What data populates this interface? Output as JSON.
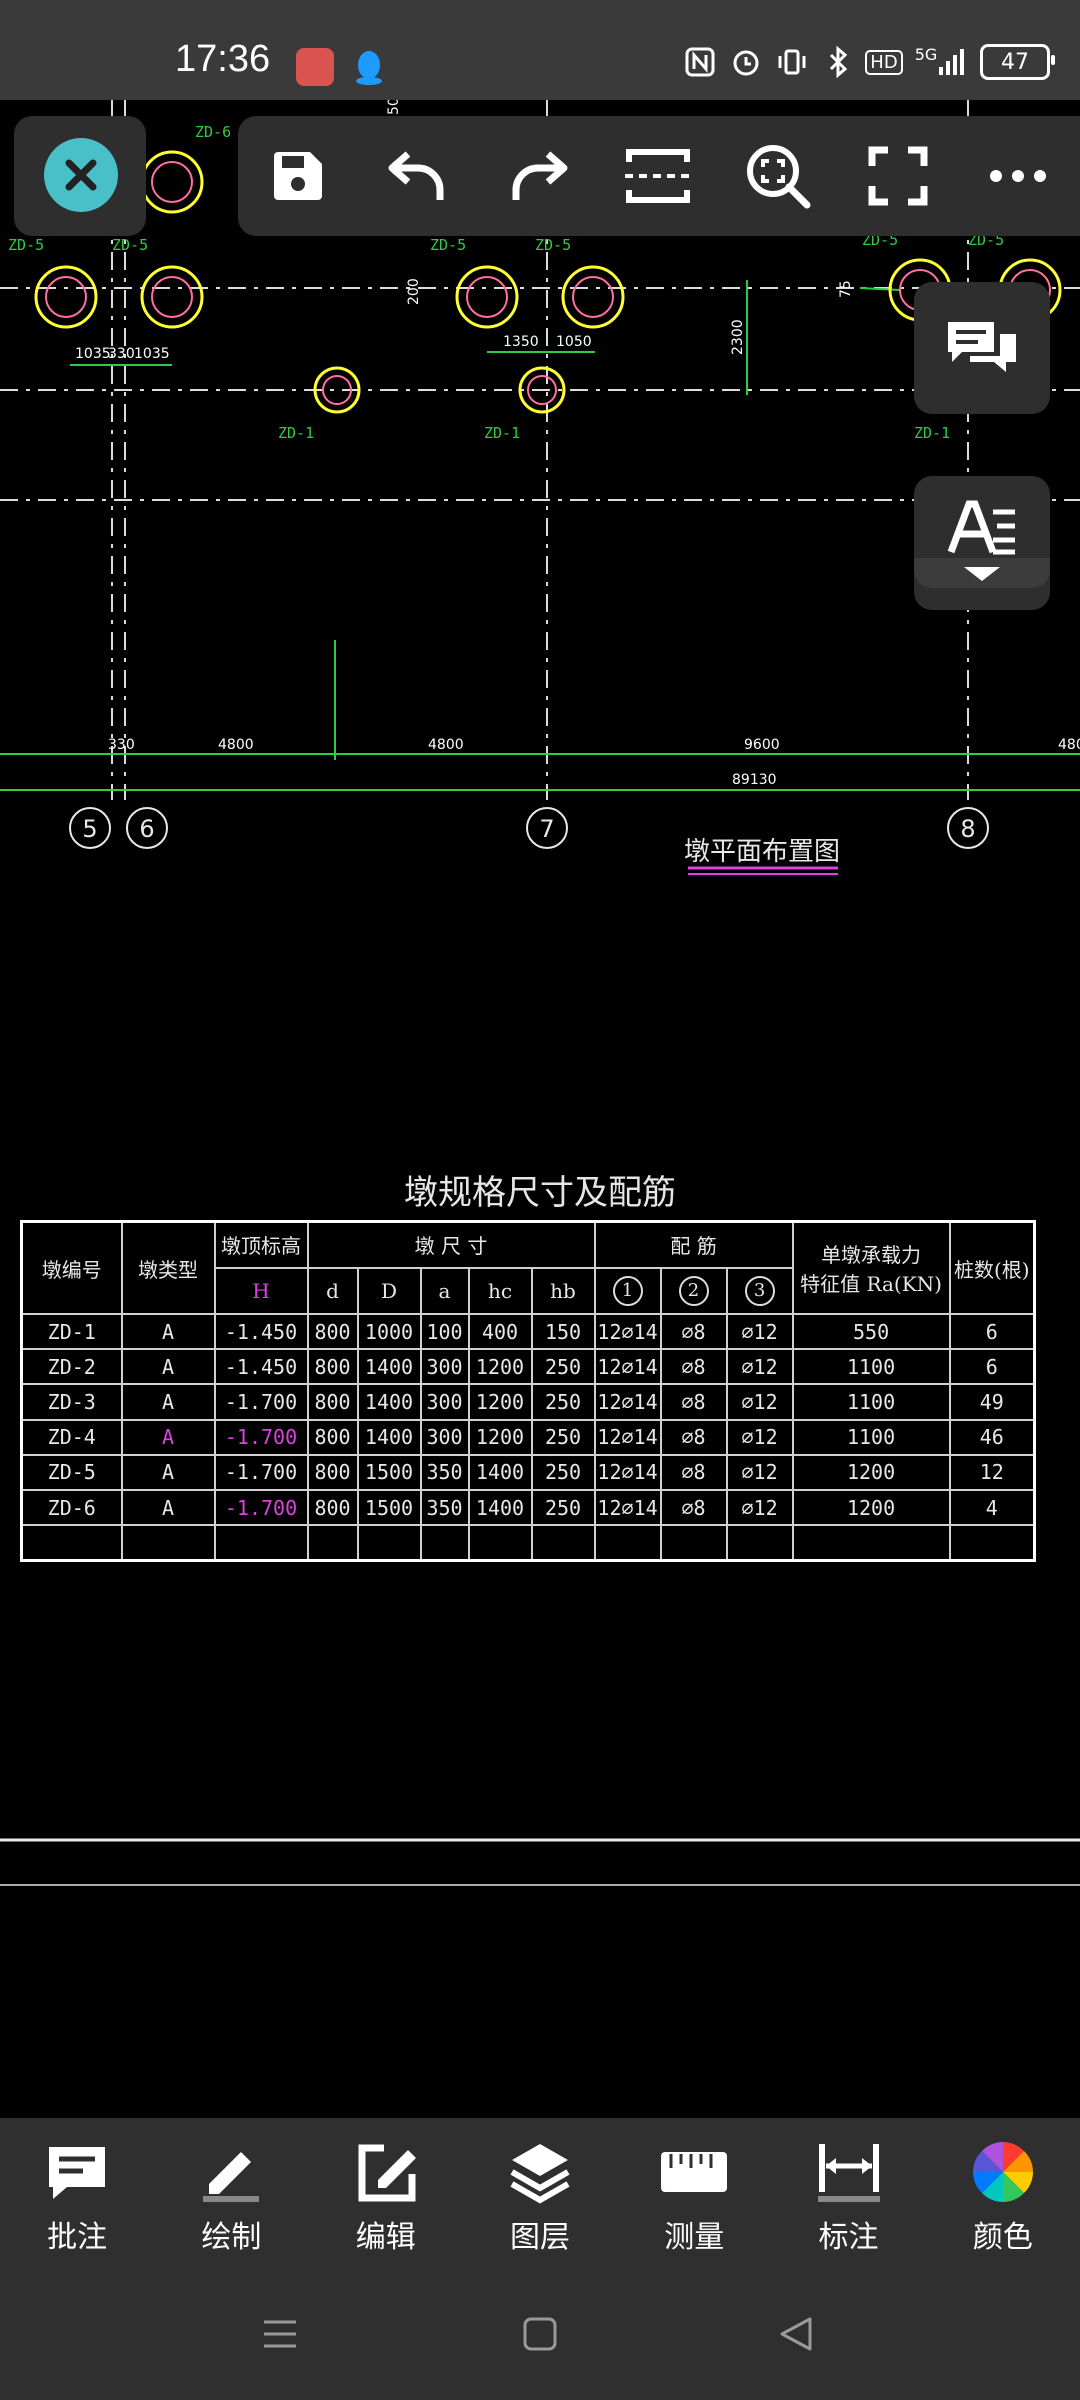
{
  "status": {
    "time": "17:36",
    "network": "5G",
    "hd": "HD",
    "battery": "47"
  },
  "drawing": {
    "pile_labels": [
      "ZD-6",
      "ZD-5",
      "ZD-5",
      "ZD-5",
      "ZD-5",
      "ZD-5",
      "ZD-5",
      "ZD-1",
      "ZD-1",
      "ZD-1"
    ],
    "dim_small": [
      "1035",
      "330",
      "1035",
      "1350",
      "1050",
      "2300",
      "200",
      "75",
      "50"
    ],
    "dim_bottom": [
      "330",
      "4800",
      "4800",
      "9600",
      "480"
    ],
    "dim_total": "89130",
    "axes": [
      "5",
      "6",
      "7",
      "8"
    ],
    "plan_title": "墩平面布置图"
  },
  "table": {
    "title": "墩规格尺寸及配筋",
    "h_pier_no": "墩编号",
    "h_pier_type": "墩类型",
    "h_top_elev": "墩顶标高",
    "h_size": "墩 尺 寸",
    "h_rebar": "配 筋",
    "h_capacity_1": "单墩承载力",
    "h_capacity_2": "特征值 Ra(KN)",
    "h_count": "桩数(根)",
    "sub": [
      "H",
      "d",
      "D",
      "a",
      "hc",
      "hb",
      "1",
      "2",
      "3"
    ],
    "rows": [
      {
        "no": "ZD-1",
        "type": "A",
        "h": "-1.450",
        "d": "800",
        "D": "1000",
        "a": "100",
        "hc": "400",
        "hb": "150",
        "r1": "12⌀14",
        "r2": "⌀8",
        "r3": "⌀12",
        "ra": "550",
        "n": "6",
        "hl": false
      },
      {
        "no": "ZD-2",
        "type": "A",
        "h": "-1.450",
        "d": "800",
        "D": "1400",
        "a": "300",
        "hc": "1200",
        "hb": "250",
        "r1": "12⌀14",
        "r2": "⌀8",
        "r3": "⌀12",
        "ra": "1100",
        "n": "6",
        "hl": false
      },
      {
        "no": "ZD-3",
        "type": "A",
        "h": "-1.700",
        "d": "800",
        "D": "1400",
        "a": "300",
        "hc": "1200",
        "hb": "250",
        "r1": "12⌀14",
        "r2": "⌀8",
        "r3": "⌀12",
        "ra": "1100",
        "n": "49",
        "hl": false
      },
      {
        "no": "ZD-4",
        "type": "A",
        "h": "-1.700",
        "d": "800",
        "D": "1400",
        "a": "300",
        "hc": "1200",
        "hb": "250",
        "r1": "12⌀14",
        "r2": "⌀8",
        "r3": "⌀12",
        "ra": "1100",
        "n": "46",
        "hl": true
      },
      {
        "no": "ZD-5",
        "type": "A",
        "h": "-1.700",
        "d": "800",
        "D": "1500",
        "a": "350",
        "hc": "1400",
        "hb": "250",
        "r1": "12⌀14",
        "r2": "⌀8",
        "r3": "⌀12",
        "ra": "1200",
        "n": "12",
        "hl": false
      },
      {
        "no": "ZD-6",
        "type": "A",
        "h": "-1.700",
        "d": "800",
        "D": "1500",
        "a": "350",
        "hc": "1400",
        "hb": "250",
        "r1": "12⌀14",
        "r2": "⌀8",
        "r3": "⌀12",
        "ra": "1200",
        "n": "4",
        "hl": "h"
      }
    ]
  },
  "bottom_tools": [
    {
      "label": "批注",
      "icon": "annotation-icon"
    },
    {
      "label": "绘制",
      "icon": "pencil-icon"
    },
    {
      "label": "编辑",
      "icon": "edit-icon"
    },
    {
      "label": "图层",
      "icon": "layers-icon"
    },
    {
      "label": "测量",
      "icon": "ruler-icon"
    },
    {
      "label": "标注",
      "icon": "dimension-icon"
    },
    {
      "label": "颜色",
      "icon": "color-wheel-icon"
    }
  ],
  "colors": {
    "accent": "#49c0c7",
    "toolbar_bg": "#2e2e2e",
    "cad_green": "#2ecc40",
    "cad_yellow": "#ffff33",
    "cad_magenta": "#e040e0"
  }
}
